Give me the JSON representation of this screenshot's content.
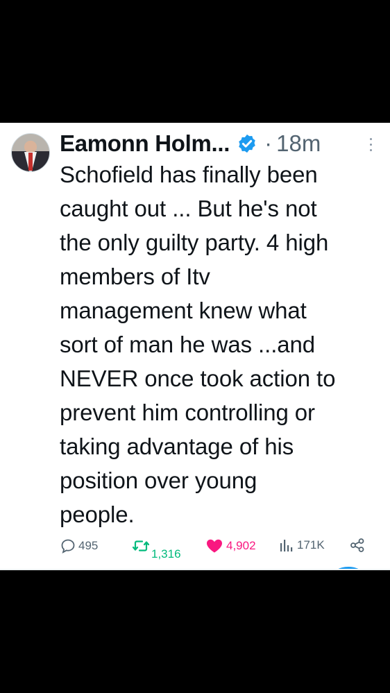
{
  "tweet": {
    "author_name": "Eamonn Holm...",
    "separator": "·",
    "time": "18m",
    "text": "Schofield has finally been\ncaught out ... But he's not\nthe only guilty party. 4 high\nmembers of Itv\nmanagement knew what\nsort of man he was ...and\nNEVER once took action to\nprevent him controlling or\ntaking advantage of his\nposition over young\npeople."
  },
  "metrics": {
    "replies": "495",
    "retweets": "1,316",
    "likes": "4,902",
    "views": "171K"
  },
  "colors": {
    "verified": "#1d9bf0",
    "retweet": "#00ba7c",
    "like": "#f91880",
    "muted": "#536471"
  },
  "icons": [
    "verified-badge-icon",
    "more-options-icon",
    "reply-icon",
    "retweet-icon",
    "like-heart-icon",
    "views-icon",
    "share-icon"
  ]
}
